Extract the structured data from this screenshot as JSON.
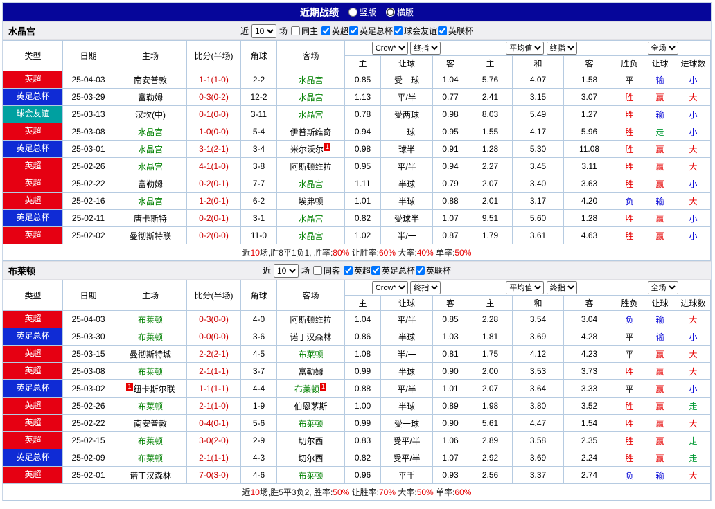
{
  "header": {
    "title": "近期战绩",
    "radio_vertical": "竖版",
    "radio_horizontal": "横版",
    "selected_layout": "横版"
  },
  "columns": {
    "main": [
      "类型",
      "日期",
      "主场",
      "比分(半场)",
      "角球",
      "客场"
    ],
    "odds_select": "Crow*",
    "final_select": "终指",
    "avg_select": "平均值",
    "scope_select": "全场",
    "sub": [
      "主",
      "让球",
      "客",
      "主",
      "和",
      "客",
      "胜负",
      "让球",
      "进球数"
    ]
  },
  "palette": {
    "red": "#e60000",
    "blue": "#0000d5",
    "green": "#009933",
    "black": "#222222",
    "score": "#cc0000",
    "focus_team": "#008000"
  },
  "league_colors": {
    "英超": "#e60012",
    "英足总杯": "#0f2bd5",
    "球会友谊": "#00a0a0"
  },
  "sections": [
    {
      "team": "水晶宫",
      "filter": {
        "near": "近",
        "count": "10",
        "games": "场",
        "same": {
          "label": "同主",
          "checked": false
        },
        "leagues": [
          {
            "label": "英超",
            "checked": true
          },
          {
            "label": "英足总杯",
            "checked": true
          },
          {
            "label": "球会友谊",
            "checked": true
          },
          {
            "label": "英联杯",
            "checked": true
          }
        ]
      },
      "rows": [
        {
          "league": "英超",
          "date": "25-04-03",
          "home": {
            "name": "南安普敦"
          },
          "score": "1-1(1-0)",
          "corner": "2-2",
          "away": {
            "name": "水晶宫",
            "focus": true
          },
          "odds": [
            "0.85",
            "受一球",
            "1.04"
          ],
          "avg": [
            "5.76",
            "4.07",
            "1.58"
          ],
          "results": [
            {
              "text": "平",
              "color": "black"
            },
            {
              "text": "输",
              "color": "blue"
            },
            {
              "text": "小",
              "color": "blue"
            }
          ]
        },
        {
          "league": "英足总杯",
          "date": "25-03-29",
          "home": {
            "name": "富勒姆"
          },
          "score": "0-3(0-2)",
          "corner": "12-2",
          "away": {
            "name": "水晶宫",
            "focus": true
          },
          "odds": [
            "1.13",
            "平/半",
            "0.77"
          ],
          "avg": [
            "2.41",
            "3.15",
            "3.07"
          ],
          "results": [
            {
              "text": "胜",
              "color": "red"
            },
            {
              "text": "赢",
              "color": "red"
            },
            {
              "text": "大",
              "color": "red"
            }
          ]
        },
        {
          "league": "球会友谊",
          "date": "25-03-13",
          "home": {
            "name": "汉坎(中)"
          },
          "score": "0-1(0-0)",
          "corner": "3-11",
          "away": {
            "name": "水晶宫",
            "focus": true
          },
          "odds": [
            "0.78",
            "受两球",
            "0.98"
          ],
          "avg": [
            "8.03",
            "5.49",
            "1.27"
          ],
          "results": [
            {
              "text": "胜",
              "color": "red"
            },
            {
              "text": "输",
              "color": "blue"
            },
            {
              "text": "小",
              "color": "blue"
            }
          ]
        },
        {
          "league": "英超",
          "date": "25-03-08",
          "home": {
            "name": "水晶宫",
            "focus": true
          },
          "score": "1-0(0-0)",
          "corner": "5-4",
          "away": {
            "name": "伊普斯维奇"
          },
          "odds": [
            "0.94",
            "一球",
            "0.95"
          ],
          "avg": [
            "1.55",
            "4.17",
            "5.96"
          ],
          "results": [
            {
              "text": "胜",
              "color": "red"
            },
            {
              "text": "走",
              "color": "green"
            },
            {
              "text": "小",
              "color": "blue"
            }
          ]
        },
        {
          "league": "英足总杯",
          "date": "25-03-01",
          "home": {
            "name": "水晶宫",
            "focus": true
          },
          "score": "3-1(2-1)",
          "corner": "3-4",
          "away": {
            "name": "米尔沃尔",
            "card_suf": "1"
          },
          "odds": [
            "0.98",
            "球半",
            "0.91"
          ],
          "avg": [
            "1.28",
            "5.30",
            "11.08"
          ],
          "results": [
            {
              "text": "胜",
              "color": "red"
            },
            {
              "text": "赢",
              "color": "red"
            },
            {
              "text": "大",
              "color": "red"
            }
          ]
        },
        {
          "league": "英超",
          "date": "25-02-26",
          "home": {
            "name": "水晶宫",
            "focus": true
          },
          "score": "4-1(1-0)",
          "corner": "3-8",
          "away": {
            "name": "阿斯顿维拉"
          },
          "odds": [
            "0.95",
            "平/半",
            "0.94"
          ],
          "avg": [
            "2.27",
            "3.45",
            "3.11"
          ],
          "results": [
            {
              "text": "胜",
              "color": "red"
            },
            {
              "text": "赢",
              "color": "red"
            },
            {
              "text": "大",
              "color": "red"
            }
          ]
        },
        {
          "league": "英超",
          "date": "25-02-22",
          "home": {
            "name": "富勒姆"
          },
          "score": "0-2(0-1)",
          "corner": "7-7",
          "away": {
            "name": "水晶宫",
            "focus": true
          },
          "odds": [
            "1.11",
            "半球",
            "0.79"
          ],
          "avg": [
            "2.07",
            "3.40",
            "3.63"
          ],
          "results": [
            {
              "text": "胜",
              "color": "red"
            },
            {
              "text": "赢",
              "color": "red"
            },
            {
              "text": "小",
              "color": "blue"
            }
          ]
        },
        {
          "league": "英超",
          "date": "25-02-16",
          "home": {
            "name": "水晶宫",
            "focus": true
          },
          "score": "1-2(0-1)",
          "corner": "6-2",
          "away": {
            "name": "埃弗顿"
          },
          "odds": [
            "1.01",
            "半球",
            "0.88"
          ],
          "avg": [
            "2.01",
            "3.17",
            "4.20"
          ],
          "results": [
            {
              "text": "负",
              "color": "blue"
            },
            {
              "text": "输",
              "color": "blue"
            },
            {
              "text": "大",
              "color": "red"
            }
          ]
        },
        {
          "league": "英足总杯",
          "date": "25-02-11",
          "home": {
            "name": "唐卡斯特"
          },
          "score": "0-2(0-1)",
          "corner": "3-1",
          "away": {
            "name": "水晶宫",
            "focus": true
          },
          "odds": [
            "0.82",
            "受球半",
            "1.07"
          ],
          "avg": [
            "9.51",
            "5.60",
            "1.28"
          ],
          "results": [
            {
              "text": "胜",
              "color": "red"
            },
            {
              "text": "赢",
              "color": "red"
            },
            {
              "text": "小",
              "color": "blue"
            }
          ]
        },
        {
          "league": "英超",
          "date": "25-02-02",
          "home": {
            "name": "曼彻斯特联"
          },
          "score": "0-2(0-0)",
          "corner": "11-0",
          "away": {
            "name": "水晶宫",
            "focus": true
          },
          "odds": [
            "1.02",
            "半/一",
            "0.87"
          ],
          "avg": [
            "1.79",
            "3.61",
            "4.63"
          ],
          "results": [
            {
              "text": "胜",
              "color": "red"
            },
            {
              "text": "赢",
              "color": "red"
            },
            {
              "text": "小",
              "color": "blue"
            }
          ]
        }
      ],
      "summary": [
        {
          "text": "近",
          "color": "black"
        },
        {
          "text": "10",
          "color": "red"
        },
        {
          "text": "场,胜8平1负1, ",
          "color": "black"
        },
        {
          "text": "胜率:",
          "color": "black"
        },
        {
          "text": "80%",
          "color": "red"
        },
        {
          "text": " 让胜率:",
          "color": "black"
        },
        {
          "text": "60%",
          "color": "red"
        },
        {
          "text": " 大率:",
          "color": "black"
        },
        {
          "text": "40%",
          "color": "red"
        },
        {
          "text": " 单率:",
          "color": "black"
        },
        {
          "text": "50%",
          "color": "red"
        }
      ]
    },
    {
      "team": "布莱顿",
      "filter": {
        "near": "近",
        "count": "10",
        "games": "场",
        "same": {
          "label": "同客",
          "checked": false
        },
        "leagues": [
          {
            "label": "英超",
            "checked": true
          },
          {
            "label": "英足总杯",
            "checked": true
          },
          {
            "label": "英联杯",
            "checked": true
          }
        ]
      },
      "rows": [
        {
          "league": "英超",
          "date": "25-04-03",
          "home": {
            "name": "布莱顿",
            "focus": true
          },
          "score": "0-3(0-0)",
          "corner": "4-0",
          "away": {
            "name": "阿斯顿维拉"
          },
          "odds": [
            "1.04",
            "平/半",
            "0.85"
          ],
          "avg": [
            "2.28",
            "3.54",
            "3.04"
          ],
          "results": [
            {
              "text": "负",
              "color": "blue"
            },
            {
              "text": "输",
              "color": "blue"
            },
            {
              "text": "大",
              "color": "red"
            }
          ]
        },
        {
          "league": "英足总杯",
          "date": "25-03-30",
          "home": {
            "name": "布莱顿",
            "focus": true
          },
          "score": "0-0(0-0)",
          "corner": "3-6",
          "away": {
            "name": "诺丁汉森林"
          },
          "odds": [
            "0.86",
            "半球",
            "1.03"
          ],
          "avg": [
            "1.81",
            "3.69",
            "4.28"
          ],
          "results": [
            {
              "text": "平",
              "color": "black"
            },
            {
              "text": "输",
              "color": "blue"
            },
            {
              "text": "小",
              "color": "blue"
            }
          ]
        },
        {
          "league": "英超",
          "date": "25-03-15",
          "home": {
            "name": "曼彻斯特城"
          },
          "score": "2-2(2-1)",
          "corner": "4-5",
          "away": {
            "name": "布莱顿",
            "focus": true
          },
          "odds": [
            "1.08",
            "半/一",
            "0.81"
          ],
          "avg": [
            "1.75",
            "4.12",
            "4.23"
          ],
          "results": [
            {
              "text": "平",
              "color": "black"
            },
            {
              "text": "赢",
              "color": "red"
            },
            {
              "text": "大",
              "color": "red"
            }
          ]
        },
        {
          "league": "英超",
          "date": "25-03-08",
          "home": {
            "name": "布莱顿",
            "focus": true
          },
          "score": "2-1(1-1)",
          "corner": "3-7",
          "away": {
            "name": "富勒姆"
          },
          "odds": [
            "0.99",
            "半球",
            "0.90"
          ],
          "avg": [
            "2.00",
            "3.53",
            "3.73"
          ],
          "results": [
            {
              "text": "胜",
              "color": "red"
            },
            {
              "text": "赢",
              "color": "red"
            },
            {
              "text": "大",
              "color": "red"
            }
          ]
        },
        {
          "league": "英足总杯",
          "date": "25-03-02",
          "home": {
            "name": "纽卡斯尔联",
            "card_pre": "1"
          },
          "score": "1-1(1-1)",
          "corner": "4-4",
          "away": {
            "name": "布莱顿",
            "focus": true,
            "card_suf": "1"
          },
          "odds": [
            "0.88",
            "平/半",
            "1.01"
          ],
          "avg": [
            "2.07",
            "3.64",
            "3.33"
          ],
          "results": [
            {
              "text": "平",
              "color": "black"
            },
            {
              "text": "赢",
              "color": "red"
            },
            {
              "text": "小",
              "color": "blue"
            }
          ]
        },
        {
          "league": "英超",
          "date": "25-02-26",
          "home": {
            "name": "布莱顿",
            "focus": true
          },
          "score": "2-1(1-0)",
          "corner": "1-9",
          "away": {
            "name": "伯恩茅斯"
          },
          "odds": [
            "1.00",
            "半球",
            "0.89"
          ],
          "avg": [
            "1.98",
            "3.80",
            "3.52"
          ],
          "results": [
            {
              "text": "胜",
              "color": "red"
            },
            {
              "text": "赢",
              "color": "red"
            },
            {
              "text": "走",
              "color": "green"
            }
          ]
        },
        {
          "league": "英超",
          "date": "25-02-22",
          "home": {
            "name": "南安普敦"
          },
          "score": "0-4(0-1)",
          "corner": "5-6",
          "away": {
            "name": "布莱顿",
            "focus": true
          },
          "odds": [
            "0.99",
            "受一球",
            "0.90"
          ],
          "avg": [
            "5.61",
            "4.47",
            "1.54"
          ],
          "results": [
            {
              "text": "胜",
              "color": "red"
            },
            {
              "text": "赢",
              "color": "red"
            },
            {
              "text": "大",
              "color": "red"
            }
          ]
        },
        {
          "league": "英超",
          "date": "25-02-15",
          "home": {
            "name": "布莱顿",
            "focus": true
          },
          "score": "3-0(2-0)",
          "corner": "2-9",
          "away": {
            "name": "切尔西"
          },
          "odds": [
            "0.83",
            "受平/半",
            "1.06"
          ],
          "avg": [
            "2.89",
            "3.58",
            "2.35"
          ],
          "results": [
            {
              "text": "胜",
              "color": "red"
            },
            {
              "text": "赢",
              "color": "red"
            },
            {
              "text": "走",
              "color": "green"
            }
          ]
        },
        {
          "league": "英足总杯",
          "date": "25-02-09",
          "home": {
            "name": "布莱顿",
            "focus": true
          },
          "score": "2-1(1-1)",
          "corner": "4-3",
          "away": {
            "name": "切尔西"
          },
          "odds": [
            "0.82",
            "受平/半",
            "1.07"
          ],
          "avg": [
            "2.92",
            "3.69",
            "2.24"
          ],
          "results": [
            {
              "text": "胜",
              "color": "red"
            },
            {
              "text": "赢",
              "color": "red"
            },
            {
              "text": "走",
              "color": "green"
            }
          ]
        },
        {
          "league": "英超",
          "date": "25-02-01",
          "home": {
            "name": "诺丁汉森林"
          },
          "score": "7-0(3-0)",
          "corner": "4-6",
          "away": {
            "name": "布莱顿",
            "focus": true
          },
          "odds": [
            "0.96",
            "平手",
            "0.93"
          ],
          "avg": [
            "2.56",
            "3.37",
            "2.74"
          ],
          "results": [
            {
              "text": "负",
              "color": "blue"
            },
            {
              "text": "输",
              "color": "blue"
            },
            {
              "text": "大",
              "color": "red"
            }
          ]
        }
      ],
      "summary": [
        {
          "text": "近",
          "color": "black"
        },
        {
          "text": "10",
          "color": "red"
        },
        {
          "text": "场,胜5平3负2, ",
          "color": "black"
        },
        {
          "text": "胜率:",
          "color": "black"
        },
        {
          "text": "50%",
          "color": "red"
        },
        {
          "text": " 让胜率:",
          "color": "black"
        },
        {
          "text": "70%",
          "color": "red"
        },
        {
          "text": " 大率:",
          "color": "black"
        },
        {
          "text": "50%",
          "color": "red"
        },
        {
          "text": " 单率:",
          "color": "black"
        },
        {
          "text": "60%",
          "color": "red"
        }
      ]
    }
  ]
}
